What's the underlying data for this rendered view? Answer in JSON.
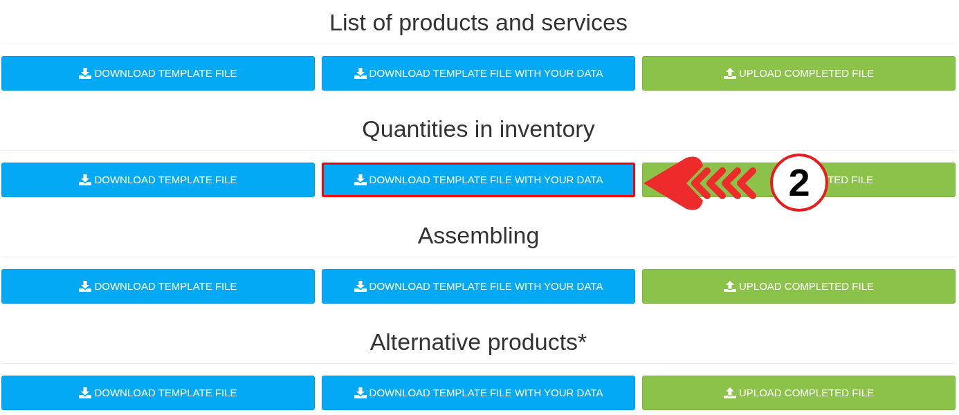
{
  "sections": [
    {
      "title": "List of products and services",
      "buttons": [
        {
          "kind": "download",
          "label": "DOWNLOAD TEMPLATE FILE",
          "highlighted": false
        },
        {
          "kind": "download",
          "label": "DOWNLOAD TEMPLATE FILE WITH YOUR DATA",
          "highlighted": false
        },
        {
          "kind": "upload",
          "label": "UPLOAD COMPLETED FILE",
          "highlighted": false
        }
      ]
    },
    {
      "title": "Quantities in inventory",
      "buttons": [
        {
          "kind": "download",
          "label": "DOWNLOAD TEMPLATE FILE",
          "highlighted": false
        },
        {
          "kind": "download",
          "label": "DOWNLOAD TEMPLATE FILE WITH YOUR DATA",
          "highlighted": true
        },
        {
          "kind": "upload_covered",
          "label": "TED FILE",
          "highlighted": false
        }
      ],
      "callout": {
        "number": "2"
      }
    },
    {
      "title": "Assembling",
      "buttons": [
        {
          "kind": "download",
          "label": "DOWNLOAD TEMPLATE FILE",
          "highlighted": false
        },
        {
          "kind": "download",
          "label": "DOWNLOAD TEMPLATE FILE WITH YOUR DATA",
          "highlighted": false
        },
        {
          "kind": "upload",
          "label": "UPLOAD COMPLETED FILE",
          "highlighted": false
        }
      ]
    },
    {
      "title": "Alternative products*",
      "buttons": [
        {
          "kind": "download",
          "label": "DOWNLOAD TEMPLATE FILE",
          "highlighted": false
        },
        {
          "kind": "download",
          "label": "DOWNLOAD TEMPLATE FILE WITH YOUR DATA",
          "highlighted": false
        },
        {
          "kind": "upload",
          "label": "UPLOAD COMPLETED FILE",
          "highlighted": false
        }
      ]
    }
  ]
}
